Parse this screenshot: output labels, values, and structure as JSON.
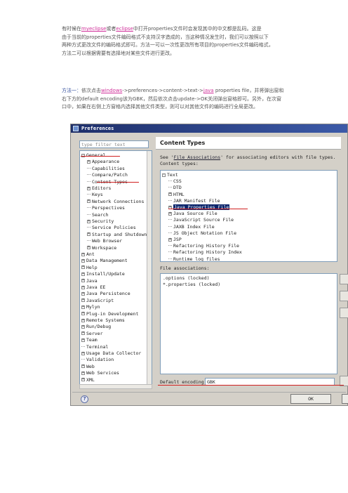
{
  "intro": {
    "l1_a": "有时候在",
    "l1_link1": "myeclipse",
    "l1_b": "或者",
    "l1_link2": "eclipse",
    "l1_c": "中打开properties文件时会发现其中的中文都是乱码。这是",
    "l2": "由于当前的properties文件编码格式不支持汉字造成的，当这种情况发生时，我们可以按照以下",
    "l3": "两种方式更改文件的编码格式即可。方法一可以一次性更改所有项目的properties文件编码格式，",
    "l4": "方法二可以根据需要有选择地对某些文件进行更改。"
  },
  "method": {
    "label": "方法一：",
    "a": "依次点击",
    "link": "windows",
    "b": "->preferences->content->text->",
    "java": "java",
    "c": " properties file，并将弹出窗和",
    "l2": "右下方的default encoding该为GBK，然后依次点击update->OK关闭弹出窗格即可。另外，在次窗",
    "l3": "口中，如果在右侧上方窗格内选择其他文件类型，则可以对其他文件的编码进行全局更改。"
  },
  "window": {
    "title": "Preferences",
    "filter_placeholder": "type filter text",
    "tree": [
      {
        "label": "General",
        "indent": 0,
        "exp": "-"
      },
      {
        "label": "Appearance",
        "indent": 1,
        "exp": "+"
      },
      {
        "label": "Capabilities",
        "indent": 1,
        "exp": ""
      },
      {
        "label": "Compare/Patch",
        "indent": 1,
        "exp": ""
      },
      {
        "label": "Content Types",
        "indent": 1,
        "exp": ""
      },
      {
        "label": "Editors",
        "indent": 1,
        "exp": "+"
      },
      {
        "label": "Keys",
        "indent": 1,
        "exp": ""
      },
      {
        "label": "Network Connections",
        "indent": 1,
        "exp": "+"
      },
      {
        "label": "Perspectives",
        "indent": 1,
        "exp": ""
      },
      {
        "label": "Search",
        "indent": 1,
        "exp": ""
      },
      {
        "label": "Security",
        "indent": 1,
        "exp": "+"
      },
      {
        "label": "Service Policies",
        "indent": 1,
        "exp": ""
      },
      {
        "label": "Startup and Shutdown",
        "indent": 1,
        "exp": "+"
      },
      {
        "label": "Web Browser",
        "indent": 1,
        "exp": ""
      },
      {
        "label": "Workspace",
        "indent": 1,
        "exp": "+"
      },
      {
        "label": "Ant",
        "indent": 0,
        "exp": "+"
      },
      {
        "label": "Data Management",
        "indent": 0,
        "exp": "+"
      },
      {
        "label": "Help",
        "indent": 0,
        "exp": "+"
      },
      {
        "label": "Install/Update",
        "indent": 0,
        "exp": "+"
      },
      {
        "label": "Java",
        "indent": 0,
        "exp": "+"
      },
      {
        "label": "Java EE",
        "indent": 0,
        "exp": "+"
      },
      {
        "label": "Java Persistence",
        "indent": 0,
        "exp": "+"
      },
      {
        "label": "JavaScript",
        "indent": 0,
        "exp": "+"
      },
      {
        "label": "Mylyn",
        "indent": 0,
        "exp": "+"
      },
      {
        "label": "Plug-in Development",
        "indent": 0,
        "exp": "+"
      },
      {
        "label": "Remote Systems",
        "indent": 0,
        "exp": "+"
      },
      {
        "label": "Run/Debug",
        "indent": 0,
        "exp": "+"
      },
      {
        "label": "Server",
        "indent": 0,
        "exp": "+"
      },
      {
        "label": "Team",
        "indent": 0,
        "exp": "+"
      },
      {
        "label": "Terminal",
        "indent": 0,
        "exp": ""
      },
      {
        "label": "Usage Data Collector",
        "indent": 0,
        "exp": "+"
      },
      {
        "label": "Validation",
        "indent": 0,
        "exp": ""
      },
      {
        "label": "Web",
        "indent": 0,
        "exp": "+"
      },
      {
        "label": "Web Services",
        "indent": 0,
        "exp": "+"
      },
      {
        "label": "XML",
        "indent": 0,
        "exp": "+"
      }
    ],
    "panel_title": "Content Types",
    "see_pre": "See '",
    "see_link": "File Associations",
    "see_post": "' for associating editors with file types.",
    "content_types_label": "Content types:",
    "content_tree": [
      {
        "label": "Text",
        "indent": 0,
        "exp": "-"
      },
      {
        "label": "CSS",
        "indent": 1,
        "exp": ""
      },
      {
        "label": "DTD",
        "indent": 1,
        "exp": ""
      },
      {
        "label": "HTML",
        "indent": 1,
        "exp": "+"
      },
      {
        "label": "JAR Manifest File",
        "indent": 1,
        "exp": ""
      },
      {
        "label": "Java Properties File",
        "indent": 1,
        "exp": "+",
        "sel": true
      },
      {
        "label": "Java Source File",
        "indent": 1,
        "exp": "+"
      },
      {
        "label": "JavaScript Source File",
        "indent": 1,
        "exp": ""
      },
      {
        "label": "JAXB Index File",
        "indent": 1,
        "exp": ""
      },
      {
        "label": "JS Object Notation File",
        "indent": 1,
        "exp": ""
      },
      {
        "label": "JSP",
        "indent": 1,
        "exp": "+"
      },
      {
        "label": "Refactoring History File",
        "indent": 1,
        "exp": ""
      },
      {
        "label": "Refactoring History Index",
        "indent": 1,
        "exp": ""
      },
      {
        "label": "Runtime log files",
        "indent": 1,
        "exp": ""
      }
    ],
    "file_assoc_label": "File associations:",
    "file_assoc": [
      ".options (locked)",
      "*.properties (locked)"
    ],
    "default_encoding_label": "Default encoding:",
    "default_encoding_value": "GBK",
    "ok_label": "OK",
    "help_glyph": "?"
  }
}
